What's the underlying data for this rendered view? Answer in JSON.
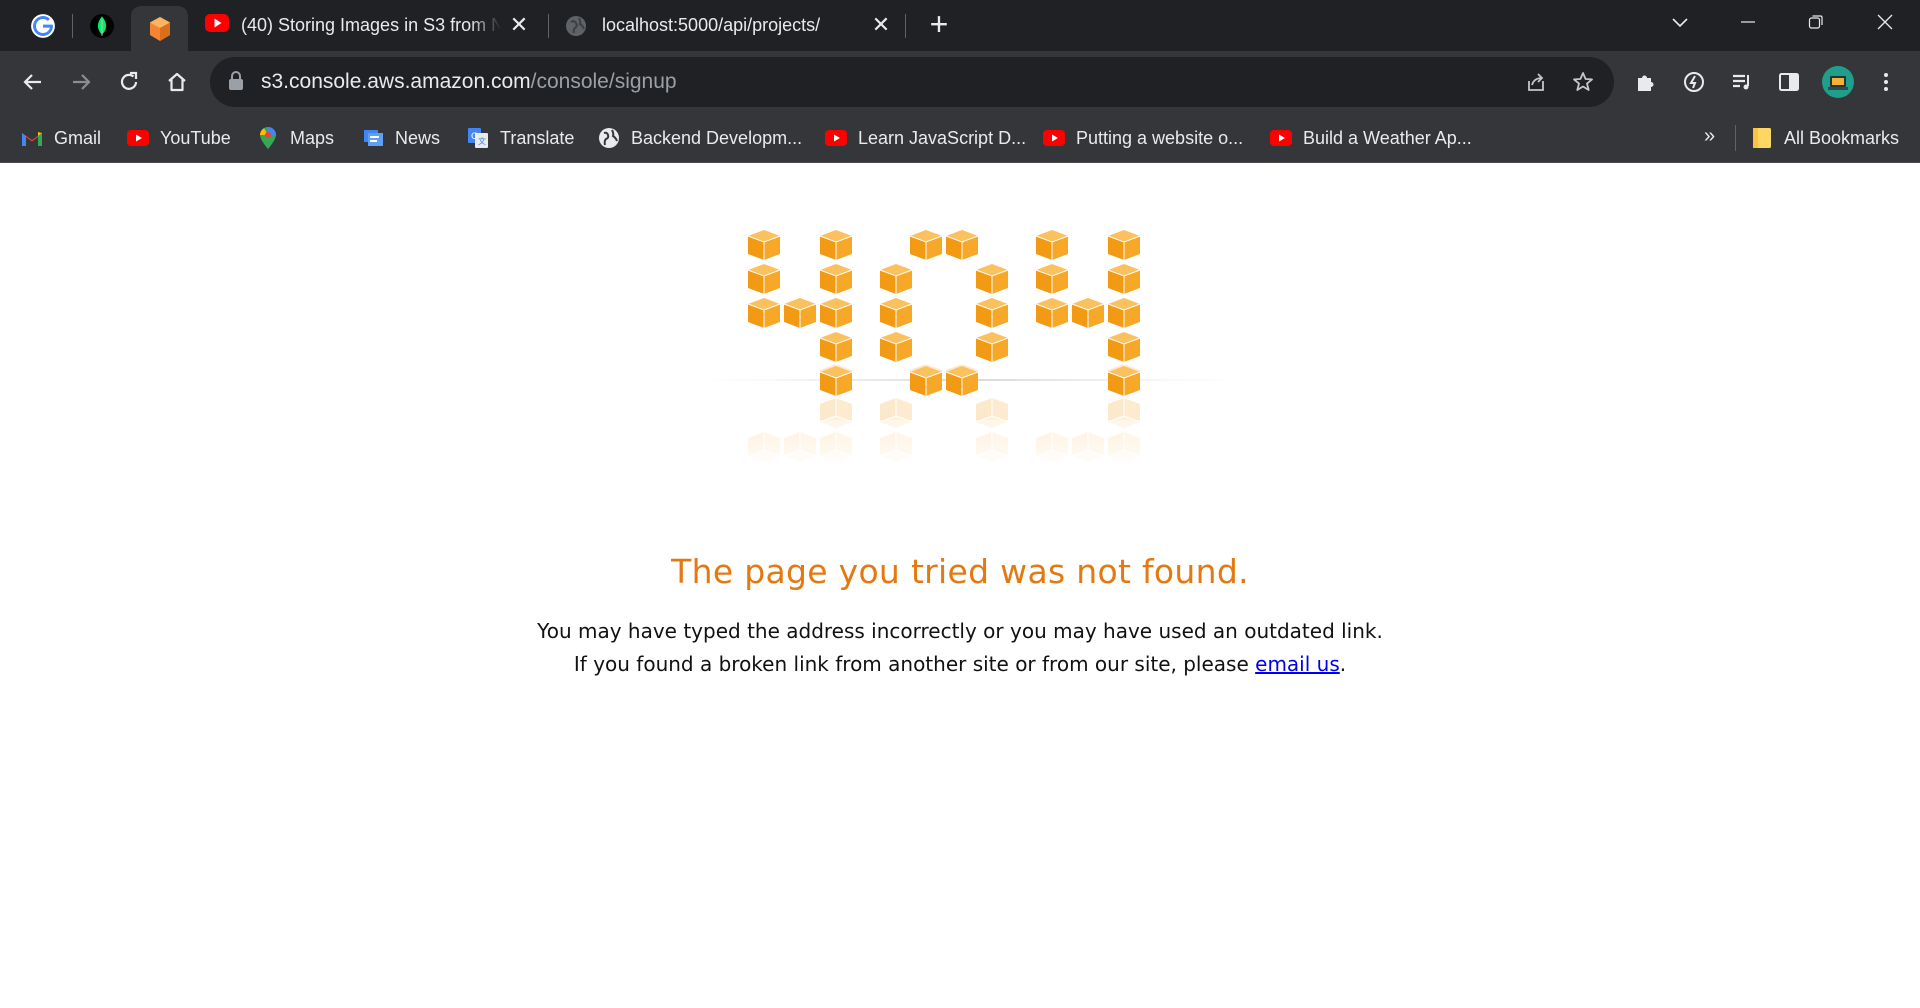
{
  "tabs": {
    "pinned": [
      {
        "name": "google-tab",
        "icon": "google-icon"
      },
      {
        "name": "mongodb-tab",
        "icon": "mongodb-leaf-icon"
      },
      {
        "name": "aws-tab",
        "icon": "aws-cube-icon",
        "active": true
      }
    ],
    "open": [
      {
        "title": "(40) Storing Images in S3 from N",
        "icon": "youtube-icon"
      },
      {
        "title": "localhost:5000/api/projects/",
        "icon": "globe-icon"
      }
    ]
  },
  "omnibox": {
    "host": "s3.console.aws.amazon.com",
    "path": "/console/signup"
  },
  "bookmarks": [
    {
      "label": "Gmail",
      "icon": "gmail-icon"
    },
    {
      "label": "YouTube",
      "icon": "youtube-icon"
    },
    {
      "label": "Maps",
      "icon": "maps-icon"
    },
    {
      "label": "News",
      "icon": "news-icon"
    },
    {
      "label": "Translate",
      "icon": "translate-icon"
    },
    {
      "label": "Backend Developm...",
      "icon": "globe-icon"
    },
    {
      "label": "Learn JavaScript D...",
      "icon": "youtube-icon"
    },
    {
      "label": "Putting a website o...",
      "icon": "youtube-icon"
    },
    {
      "label": "Build a Weather Ap...",
      "icon": "youtube-icon"
    }
  ],
  "bookmarks_overflow": "»",
  "all_bookmarks": {
    "label": "All Bookmarks",
    "icon": "folder-icon"
  },
  "page": {
    "graphic_text": "404",
    "headline": "The page you tried was not found.",
    "line1": "You may have typed the address incorrectly or you may have used an outdated link.",
    "line2_prefix": "If you found a broken link from another site or from our site, please ",
    "line2_link": "email us",
    "line2_suffix": "."
  },
  "colors": {
    "accent": "#e47911",
    "cube": "#f7a21b",
    "link": "#0000ee",
    "chrome_dark": "#202124",
    "chrome_toolbar": "#35363a"
  }
}
